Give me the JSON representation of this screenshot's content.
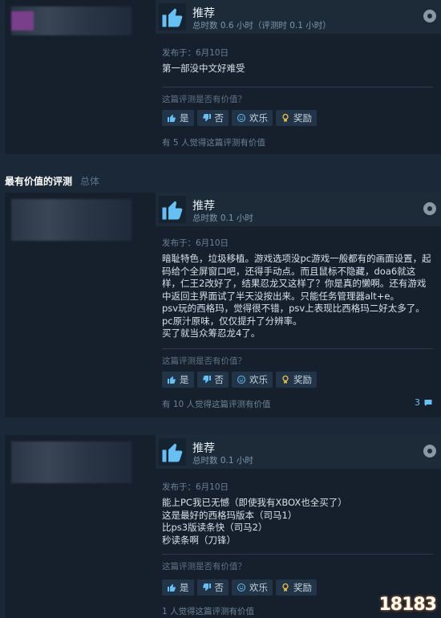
{
  "section": {
    "title": "最有价值的评测",
    "filter": "总体"
  },
  "common": {
    "recommend": "推荐",
    "helpful_question": "这篇评测是否有价值？",
    "btn_yes": "是",
    "btn_no": "否",
    "btn_funny": "欢乐",
    "btn_award": "奖励"
  },
  "reviews": [
    {
      "hours": "总时数 0.6 小时（评测时 0.1 小时）",
      "posted": "发布于：6月10日",
      "lines": [
        "第一部没中文好难受"
      ],
      "found": "有 5 人觉得这篇评测有价值"
    },
    {
      "hours": "总时数 0.1 小时",
      "posted": "发布于：6月10日",
      "lines": [
        "暗耻特色，垃圾移植。游戏选项没pc游戏一般都有的画面设置，起码给个全屏窗口吧，还得手动点。而且鼠标不隐藏，doa6就这样，仁王2改好了，结果忍龙又这样了？你是真的懒啊。还有游戏中返回主界面试了半天没按出来。只能任务管理器alt+e。",
        "psv玩的西格玛，觉得很不错，psv上表现比西格玛二好太多了。pc原汁原味，仅仅提升了分辨率。",
        "买了就当众筹忍龙4了。"
      ],
      "found": "有 10 人觉得这篇评测有价值",
      "comments": "3"
    },
    {
      "hours": "总时数 0.1 小时",
      "posted": "发布于：6月10日",
      "lines": [
        "能上PC我已无憾（即使我有XBOX也全买了）",
        "这是最好的西格玛版本（司马1）",
        "比ps3版读条快（司马2）",
        "秒读条啊（刀锋）"
      ],
      "found": "1 人觉得这篇评测有价值"
    }
  ],
  "watermark": "18183"
}
